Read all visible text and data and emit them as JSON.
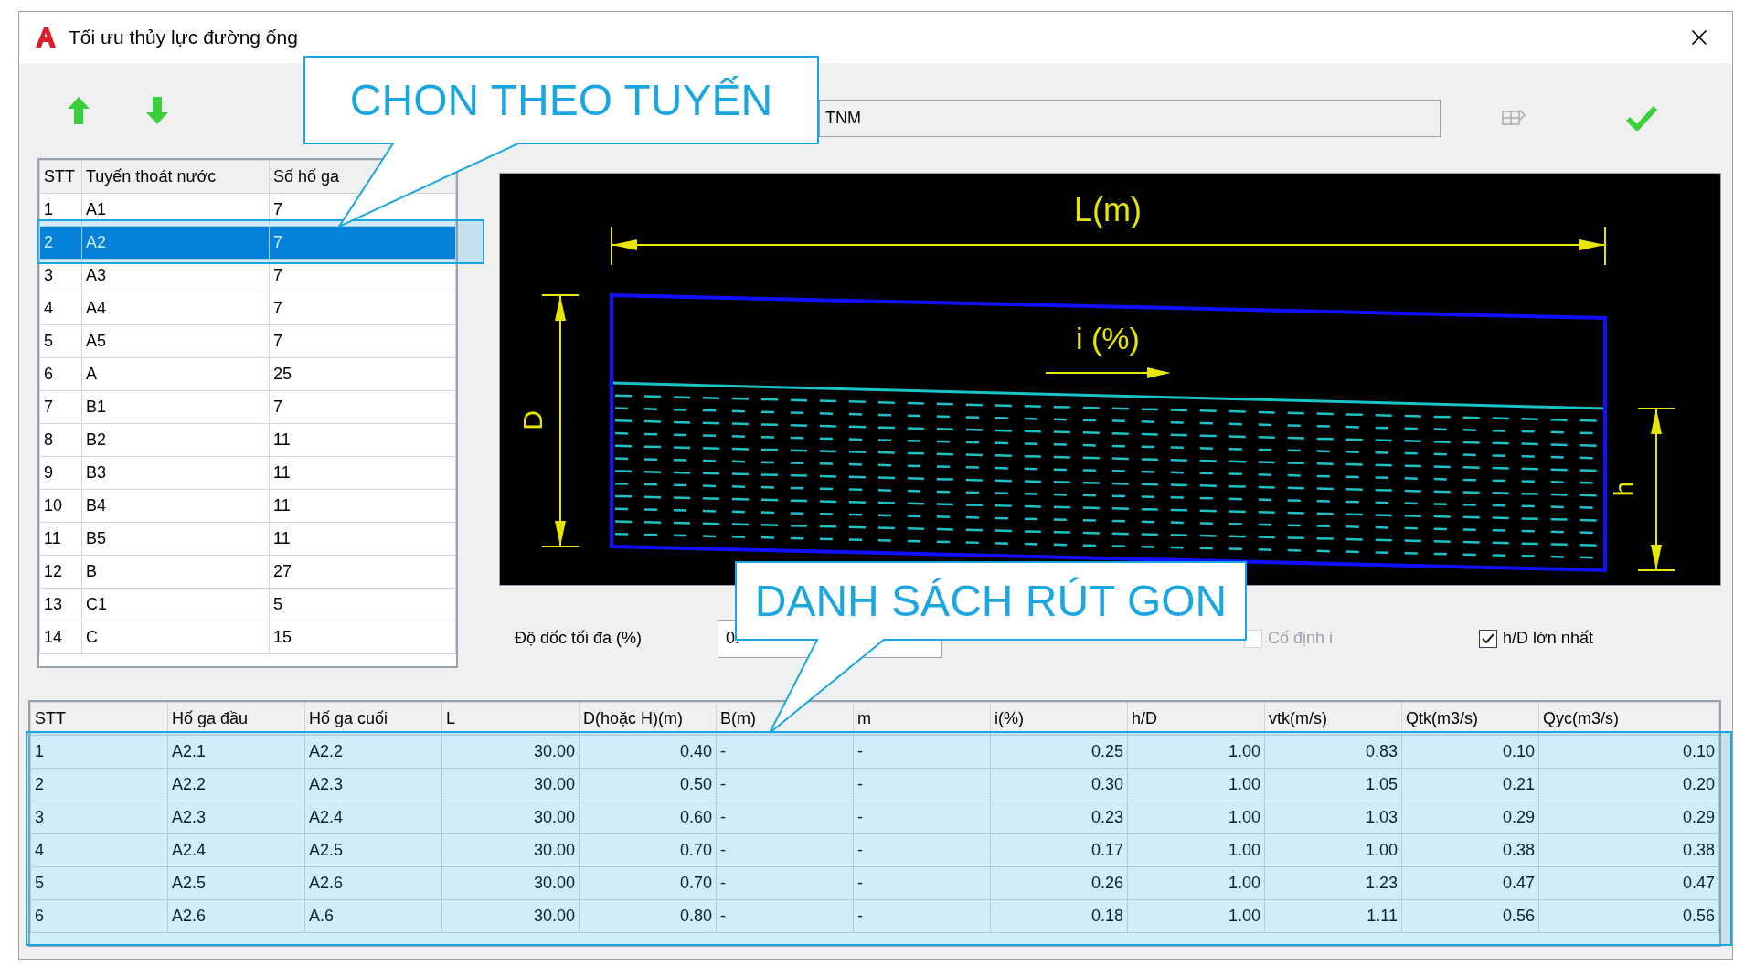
{
  "window": {
    "title": "Tối ưu thủy lực đường ống"
  },
  "route_field": {
    "value": "TNM"
  },
  "routes": {
    "columns": [
      "STT",
      "Tuyến thoát nước",
      "Số hố ga"
    ],
    "rows": [
      {
        "cells": [
          "1",
          "A1",
          "7"
        ],
        "selected": false
      },
      {
        "cells": [
          "2",
          "A2",
          "7"
        ],
        "selected": true
      },
      {
        "cells": [
          "3",
          "A3",
          "7"
        ],
        "selected": false
      },
      {
        "cells": [
          "4",
          "A4",
          "7"
        ],
        "selected": false
      },
      {
        "cells": [
          "5",
          "A5",
          "7"
        ],
        "selected": false
      },
      {
        "cells": [
          "6",
          "A",
          "25"
        ],
        "selected": false
      },
      {
        "cells": [
          "7",
          "B1",
          "7"
        ],
        "selected": false
      },
      {
        "cells": [
          "8",
          "B2",
          "11"
        ],
        "selected": false
      },
      {
        "cells": [
          "9",
          "B3",
          "11"
        ],
        "selected": false
      },
      {
        "cells": [
          "10",
          "B4",
          "11"
        ],
        "selected": false
      },
      {
        "cells": [
          "11",
          "B5",
          "11"
        ],
        "selected": false
      },
      {
        "cells": [
          "12",
          "B",
          "27"
        ],
        "selected": false
      },
      {
        "cells": [
          "13",
          "C1",
          "5"
        ],
        "selected": false
      },
      {
        "cells": [
          "14",
          "C",
          "15"
        ],
        "selected": false
      }
    ]
  },
  "diagram": {
    "length": "L(m)",
    "slope": "i (%)",
    "diameter": "D",
    "depth": "h"
  },
  "controls": {
    "max_slope_label": "Độ dốc tối đa (%)",
    "max_slope_value": "0.",
    "checkboxes": [
      {
        "label": "Cố định i",
        "checked": false,
        "disabled": true
      },
      {
        "label": "h/D lớn nhất",
        "checked": true,
        "disabled": false
      }
    ]
  },
  "segments": {
    "columns": [
      "STT",
      "Hố ga đầu",
      "Hố ga cuối",
      "L",
      "D(hoặc H)(m)",
      "B(m)",
      "m",
      "i(%)",
      "h/D",
      "vtk(m/s)",
      "Qtk(m3/s)",
      "Qyc(m3/s)"
    ],
    "rows": [
      [
        "1",
        "A2.1",
        "A2.2",
        "30.00",
        "0.40",
        "-",
        "-",
        "0.25",
        "1.00",
        "0.83",
        "0.10",
        "0.10"
      ],
      [
        "2",
        "A2.2",
        "A2.3",
        "30.00",
        "0.50",
        "-",
        "-",
        "0.30",
        "1.00",
        "1.05",
        "0.21",
        "0.20"
      ],
      [
        "3",
        "A2.3",
        "A2.4",
        "30.00",
        "0.60",
        "-",
        "-",
        "0.23",
        "1.00",
        "1.03",
        "0.29",
        "0.29"
      ],
      [
        "4",
        "A2.4",
        "A2.5",
        "30.00",
        "0.70",
        "-",
        "-",
        "0.17",
        "1.00",
        "1.00",
        "0.38",
        "0.38"
      ],
      [
        "5",
        "A2.5",
        "A2.6",
        "30.00",
        "0.70",
        "-",
        "-",
        "0.26",
        "1.00",
        "1.23",
        "0.47",
        "0.47"
      ],
      [
        "6",
        "A2.6",
        "A.6",
        "30.00",
        "0.80",
        "-",
        "-",
        "0.18",
        "1.00",
        "1.11",
        "0.56",
        "0.56"
      ]
    ]
  },
  "callouts": [
    {
      "text": "CHON THEO TUYẾN"
    },
    {
      "text": "DANH SÁCH RÚT GON"
    }
  ]
}
